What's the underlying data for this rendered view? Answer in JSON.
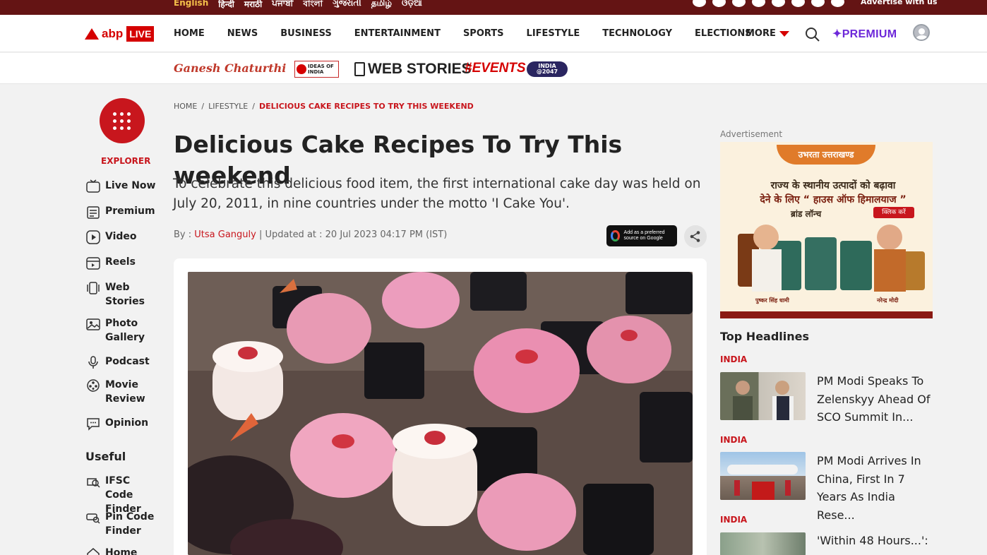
{
  "top_bar": {
    "languages": [
      "English",
      "हिन्दी",
      "मराठी",
      "ਪੰਜਾਬੀ",
      "বাংলা",
      "ગુજરાતી",
      "தமிழ்",
      "ଓଡ଼ିଆ"
    ],
    "social_icons": [
      "x-icon",
      "facebook-icon",
      "threads-icon",
      "youtube-icon",
      "instagram-icon",
      "pinterest-icon",
      "telegram-icon",
      "whatsapp-icon"
    ],
    "advertise": "Advertise with us"
  },
  "nav": {
    "logo_text": "abp",
    "logo_live": "LIVE",
    "items": [
      "HOME",
      "NEWS",
      "BUSINESS",
      "ENTERTAINMENT",
      "SPORTS",
      "LIFESTYLE",
      "TECHNOLOGY",
      "ELECTIONS"
    ],
    "more": "MORE",
    "premium": "✦PREMIUM"
  },
  "promo": {
    "ganesh": "Ganesh Chaturthi",
    "ideas": "IDEAS OF INDIA",
    "web_stories": "WEB STORIES",
    "events": "#EVENTS",
    "badge": "INDIA @2047"
  },
  "sidebar": {
    "explorer": "EXPLORER",
    "items": [
      {
        "label": "Live Now",
        "icon": "live-icon"
      },
      {
        "label": "Premium",
        "icon": "premium-icon"
      },
      {
        "label": "Video",
        "icon": "video-icon"
      },
      {
        "label": "Reels",
        "icon": "reels-icon"
      },
      {
        "label": "Web Stories",
        "icon": "web-stories-icon"
      },
      {
        "label": "Photo Gallery",
        "icon": "photo-gallery-icon"
      },
      {
        "label": "Podcast",
        "icon": "podcast-icon"
      },
      {
        "label": "Movie Review",
        "icon": "movie-review-icon"
      },
      {
        "label": "Opinion",
        "icon": "opinion-icon"
      }
    ],
    "useful_title": "Useful",
    "useful_items": [
      {
        "label": "IFSC Code Finder",
        "icon": "ifsc-icon"
      },
      {
        "label": "Pin Code Finder",
        "icon": "pin-code-icon"
      },
      {
        "label": "Home",
        "icon": "home-icon"
      }
    ]
  },
  "article": {
    "breadcrumb": [
      "HOME",
      "LIFESTYLE",
      "DELICIOUS CAKE RECIPES TO TRY THIS WEEKEND"
    ],
    "title": "Delicious Cake Recipes To Try This weekend",
    "summary": "To celebrate this delicious food item, the first international cake day was held on July 20, 2011, in nine countries under the motto 'I Cake You'.",
    "by_label": "By :",
    "author": "Utsa Ganguly",
    "updated": "| Updated at : 20 Jul 2023 04:17 PM (IST)",
    "google_badge": "Add as a preferred source on Google"
  },
  "right": {
    "ad_label": "Advertisement",
    "ad": {
      "title": "उभरता उत्तराखण्ड",
      "line1": "राज्य के स्थानीय उत्पादों को बढ़ावा",
      "line2": "देने के लिए “ हाउस ऑफ हिमालयाज ”",
      "line3": "ब्रांड लॉन्च",
      "cta": "क्लिक करें",
      "name1": "पुष्कर सिंह धामी",
      "name2": "नरेन्द्र मोदी"
    },
    "top_headlines_title": "Top Headlines",
    "headlines": [
      {
        "tag": "INDIA",
        "text": "PM Modi Speaks To Zelenskyy Ahead Of SCO Summit In..."
      },
      {
        "tag": "INDIA",
        "text": "PM Modi Arrives In China, First In 7 Years As India Rese..."
      },
      {
        "tag": "INDIA",
        "text": "'Within 48 Hours...':"
      }
    ]
  },
  "colors": {
    "brand_red": "#c8161d",
    "top_bar": "#641414",
    "premium_purple": "#6d28d9"
  }
}
